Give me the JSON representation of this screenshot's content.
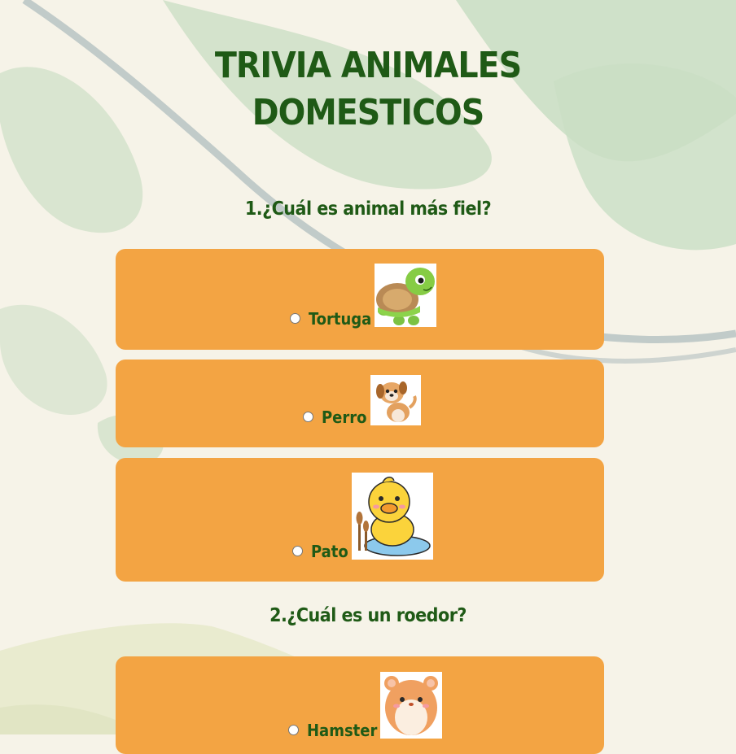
{
  "title": [
    "TRIVIA ANIMALES",
    "DOMESTICOS"
  ],
  "questions": [
    {
      "text": "1.¿Cuál es animal más fiel?",
      "options": [
        {
          "label": "Tortuga",
          "icon": "turtle-icon"
        },
        {
          "label": "Perro",
          "icon": "dog-icon"
        },
        {
          "label": "Pato",
          "icon": "duck-icon"
        }
      ]
    },
    {
      "text": "2.¿Cuál es un roedor?",
      "options": [
        {
          "label": "Hamster",
          "icon": "hamster-icon"
        }
      ]
    }
  ],
  "colors": {
    "background": "#f6f3e8",
    "leaf": "#c6dcc0",
    "vine": "#b4c0c0",
    "card": "#f3a443",
    "text": "#1f5a16"
  }
}
